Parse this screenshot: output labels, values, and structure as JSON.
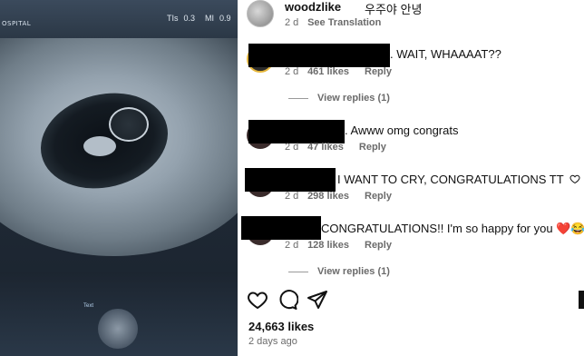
{
  "scan": {
    "hospital_label": "OSPITAL",
    "tis_label": "TIs",
    "tis_value": "0.3",
    "mi_label": "MI",
    "mi_value": "0.9",
    "panel_label": "Text"
  },
  "post": {
    "owner": {
      "username": "woodzlike",
      "caption": "우주야 안녕",
      "time": "2 d",
      "translate": "See Translation"
    },
    "comments": [
      {
        "text": ". WAIT, WHAAAAT??",
        "time": "2 d",
        "likes": "461 likes",
        "reply": "Reply"
      },
      {
        "text": ". Awww omg congrats",
        "time": "2 d",
        "likes": "47 likes",
        "reply": "Reply"
      },
      {
        "text": "I WANT TO CRY, CONGRATULATIONS TT",
        "time": "2 d",
        "likes": "298 likes",
        "reply": "Reply"
      },
      {
        "text": "CONGRATULATIONS!! I'm so happy for you ❤️😂",
        "time": "2 d",
        "likes": "128 likes",
        "reply": "Reply"
      }
    ],
    "view_replies": "View replies (1)",
    "total_likes": "24,663 likes",
    "posted_ago": "2 days ago"
  },
  "icons": {
    "like": "heart-outline-icon",
    "comment": "speech-bubble-icon",
    "share": "paper-plane-icon",
    "save": "bookmark-icon",
    "comment_like": "heart-outline-icon"
  },
  "colors": {
    "text": "#111111",
    "meta": "#6b6b6b",
    "redaction": "#000000",
    "story_ring": "#e6b73c"
  }
}
